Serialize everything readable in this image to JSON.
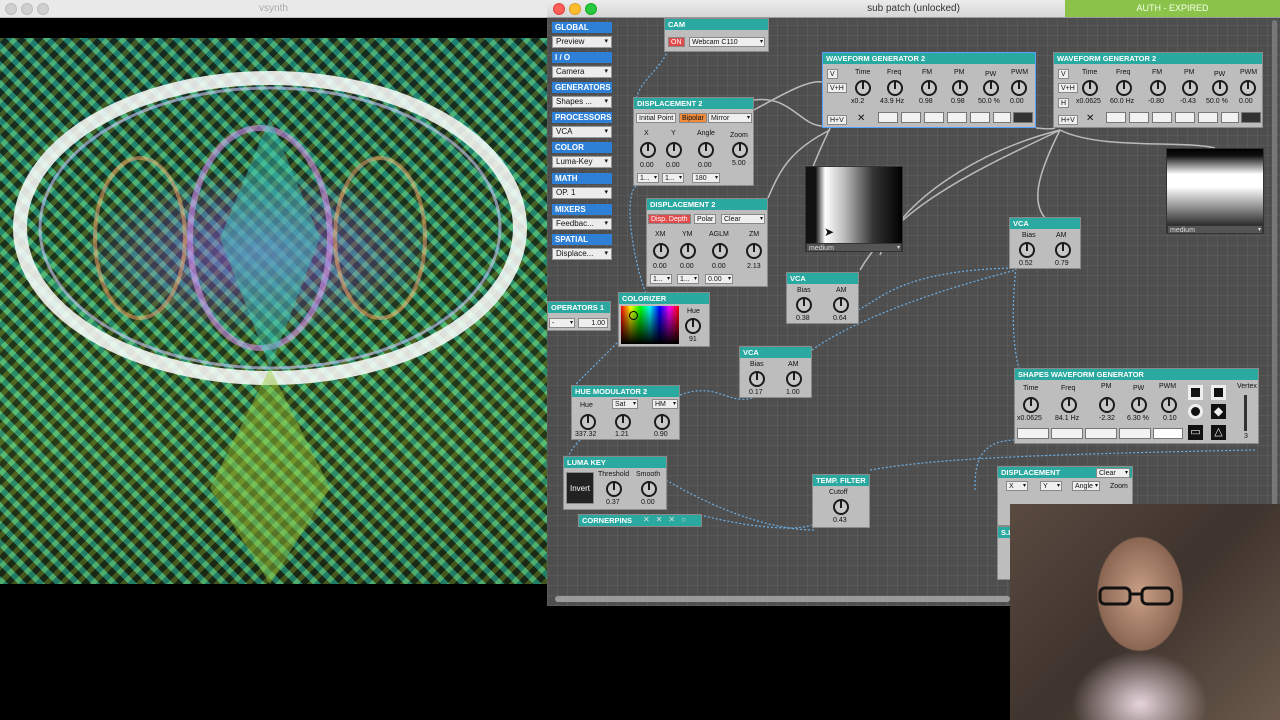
{
  "video_window": {
    "title": "vsynth"
  },
  "patch_window": {
    "title": "sub patch (unlocked)",
    "auth_status": "AUTH - EXPIRED"
  },
  "palette": [
    {
      "header": "GLOBAL",
      "select": "Preview"
    },
    {
      "header": "I / O",
      "select": "Camera"
    },
    {
      "header": "GENERATORS",
      "select": "Shapes ..."
    },
    {
      "header": "PROCESSORS",
      "select": "VCA"
    },
    {
      "header": "COLOR",
      "select": "Luma-Key"
    },
    {
      "header": "MATH",
      "select": "OP. 1"
    },
    {
      "header": "MIXERS",
      "select": "Feedbac..."
    },
    {
      "header": "SPATIAL",
      "select": "Displace..."
    }
  ],
  "cam": {
    "title": "CAM",
    "on": "ON",
    "device": "Webcam C110"
  },
  "wg1": {
    "title": "WAVEFORM GENERATOR 2",
    "v": "V",
    "vh": "V+H",
    "hv": "H+V",
    "x": "✕",
    "labels": [
      "Time",
      "Freq",
      "FM",
      "PM",
      "PW",
      "PWM"
    ],
    "values": [
      "x0.2",
      "43.9 Hz",
      "0.98",
      "0.98",
      "50.0 %",
      "0.00"
    ]
  },
  "wg2": {
    "title": "WAVEFORM GENERATOR 2",
    "v": "V",
    "vh": "V+H",
    "h": "H",
    "hv": "H+V",
    "x": "✕",
    "labels": [
      "Time",
      "Freq",
      "FM",
      "PM",
      "PW",
      "PWM"
    ],
    "values": [
      "x0.0625",
      "60.0 Hz",
      "-0.80",
      "-0.43",
      "50.0 %",
      "0.00"
    ]
  },
  "disp_a": {
    "title": "DISPLACEMENT 2",
    "initial": "Initial Point",
    "bipolar": "Bipolar",
    "mode": "Mirror",
    "labels": [
      "X",
      "Y",
      "Angle",
      "Zoom"
    ],
    "values": [
      "0.00",
      "0.00",
      "0.00",
      "5.00"
    ],
    "selects": [
      "1...",
      "1...",
      "180"
    ]
  },
  "disp_b": {
    "title": "DISPLACEMENT 2",
    "depth": "Disp. Depth",
    "polar": "Polar",
    "mode": "Clear",
    "labels": [
      "XM",
      "YM",
      "AGLM",
      "ZM"
    ],
    "values": [
      "0.00",
      "0.00",
      "0.00",
      "2.13"
    ],
    "selects": [
      "1...",
      "1...",
      "0.00"
    ]
  },
  "gradient1": {
    "label": "medium"
  },
  "gradient2": {
    "label": "medium"
  },
  "vca1": {
    "title": "VCA",
    "labels": [
      "Bias",
      "AM"
    ],
    "values": [
      "0.52",
      "0.79"
    ]
  },
  "vca2": {
    "title": "VCA",
    "labels": [
      "Bias",
      "AM"
    ],
    "values": [
      "0.38",
      "0.64"
    ]
  },
  "vca3": {
    "title": "VCA",
    "labels": [
      "Bias",
      "AM"
    ],
    "values": [
      "0.17",
      "1.00"
    ]
  },
  "operators": {
    "title": "OPERATORS 1",
    "op": "-",
    "value": "1.00"
  },
  "colorizer": {
    "title": "COLORIZER",
    "label": "Hue",
    "value": "91"
  },
  "hue_mod": {
    "title": "HUE MODULATOR 2",
    "labels": [
      "Hue",
      "Sat",
      "HM"
    ],
    "values": [
      "337.32",
      "1.21",
      "0.90"
    ]
  },
  "luma_key": {
    "title": "LUMA KEY",
    "invert": "Invert",
    "labels": [
      "Threshold",
      "Smooth"
    ],
    "values": [
      "0.37",
      "0.00"
    ]
  },
  "cornerpins": {
    "title": "CORNERPINS"
  },
  "temp_filter": {
    "title": "TEMP. FILTER",
    "label": "Cutoff",
    "value": "0.43"
  },
  "shapes": {
    "title": "SHAPES WAVEFORM GENERATOR",
    "labels": [
      "Time",
      "Freq",
      "PM",
      "PW",
      "PWM",
      "Vertex"
    ],
    "values": [
      "x0.0625",
      "84.1 Hz",
      "-2.32",
      "6.30 %",
      "0.10",
      "3"
    ]
  },
  "disp_c": {
    "title": "DISPLACEMENT",
    "mode": "Clear",
    "labels": [
      "X",
      "Y",
      "Angle",
      "Zoom"
    ]
  },
  "partial_title": "S.L",
  "colors": {
    "module_header": "#2aa9a0",
    "palette_header": "#2e7fd6",
    "auth": "#8bc34a",
    "wire": "#6ab0e8"
  }
}
